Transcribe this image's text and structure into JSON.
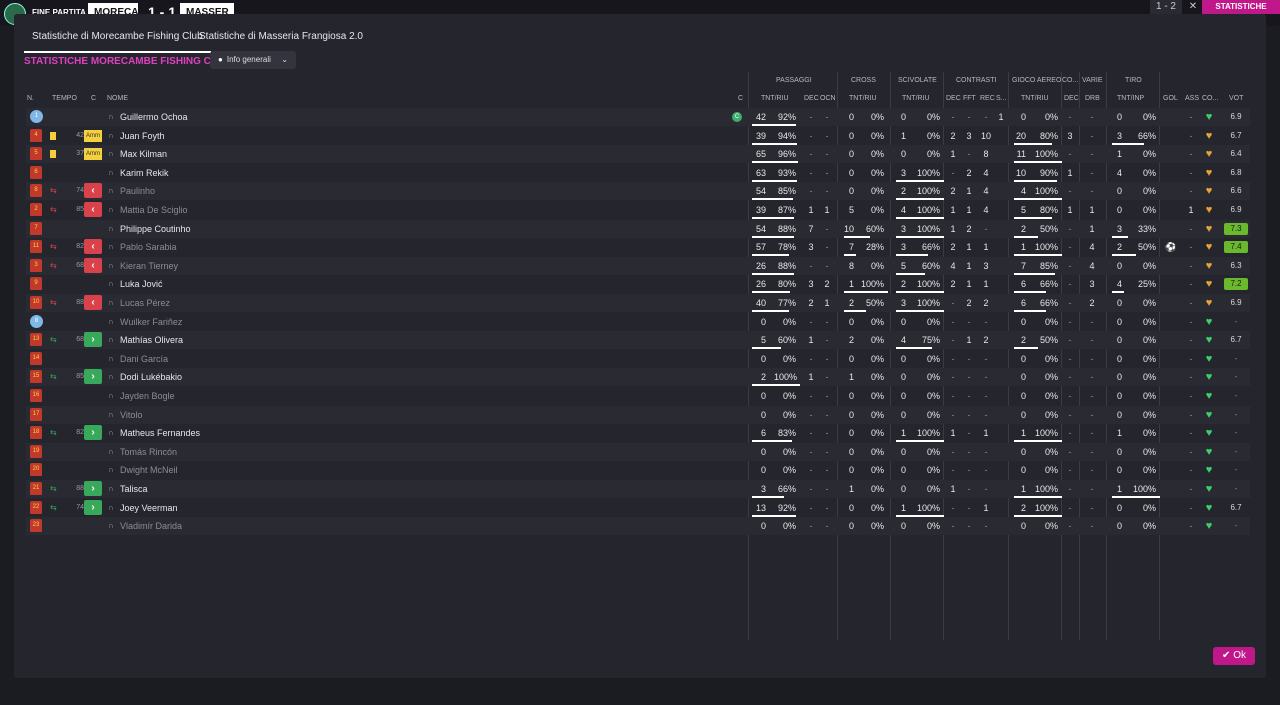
{
  "topbar": {
    "label": "FINE PARTITA",
    "team_home": "MORECA",
    "score": "1 - 1",
    "team_away": "MASSER",
    "right_score": "1 - 2",
    "right_x": "✕",
    "right_btn": "STATISTICHE"
  },
  "tabs": [
    {
      "label": "Statistiche di Morecambe Fishing Club"
    },
    {
      "label": "Statistiche di Masseria Frangiosa 2.0"
    }
  ],
  "heading": "STATISTICHE MORECAMBE FISHING CLUB",
  "dropdown": {
    "label": "Info generali"
  },
  "groups": [
    "PASSAGGI",
    "CROSS",
    "SCIVOLATE",
    "CONTRASTI",
    "GIOCO AEREO",
    "CO...",
    "VARIE",
    "TIRO"
  ],
  "cols": {
    "n": "N.",
    "tempo": "TEMPO",
    "c": "C",
    "nome": "NOME",
    "c2": "C",
    "pass": "TNT/RIU",
    "pdec": "DEC",
    "pocn": "OCN",
    "cross": "TNT/RIU",
    "sciv": "TNT/RIU",
    "cdec": "DEC",
    "cfft": "FFT",
    "crec": "REC",
    "cs": "S...",
    "aer": "TNT/RIU",
    "codec": "DEC",
    "drb": "DRB",
    "tiro": "TNT/INP",
    "gol": "GOL",
    "ass": "ASS",
    "co": "CO...",
    "vot": "VOT"
  },
  "players": [
    {
      "n": "1",
      "gk": true,
      "tempo": "",
      "card": "",
      "sub": "",
      "name": "Guillermo Ochoa",
      "cap": "C",
      "p": [
        "42",
        "92%"
      ],
      "pdec": "-",
      "pocn": "-",
      "cr": [
        "0",
        "0%"
      ],
      "sc": [
        "0",
        "0%"
      ],
      "cdec": "-",
      "cfft": "-",
      "crec": "-",
      "cs": "1",
      "ae": [
        "0",
        "0%"
      ],
      "codec": "-",
      "drb": "-",
      "ti": [
        "0",
        "0%"
      ],
      "gol": "",
      "ass": "-",
      "heart": "g",
      "vote": "6.9",
      "hi": false,
      "dim": false
    },
    {
      "n": "4",
      "tempo": "42",
      "card": "y",
      "cardlabel": "Amm",
      "sub": "",
      "name": "Juan Foyth",
      "p": [
        "39",
        "94%"
      ],
      "pdec": "-",
      "pocn": "-",
      "cr": [
        "0",
        "0%"
      ],
      "sc": [
        "1",
        "0%"
      ],
      "cdec": "2",
      "cfft": "3",
      "crec": "10",
      "cs": "",
      "ae": [
        "20",
        "80%"
      ],
      "codec": "3",
      "drb": "-",
      "ti": [
        "3",
        "66%"
      ],
      "gol": "",
      "ass": "-",
      "heart": "o",
      "vote": "6.7",
      "hi": false,
      "dim": false
    },
    {
      "n": "5",
      "tempo": "37",
      "card": "y",
      "cardlabel": "Amm",
      "sub": "",
      "name": "Max Kilman",
      "p": [
        "65",
        "96%"
      ],
      "pdec": "-",
      "pocn": "-",
      "cr": [
        "0",
        "0%"
      ],
      "sc": [
        "0",
        "0%"
      ],
      "cdec": "1",
      "cfft": "-",
      "crec": "8",
      "cs": "",
      "ae": [
        "11",
        "100%"
      ],
      "codec": "-",
      "drb": "-",
      "ti": [
        "1",
        "0%"
      ],
      "gol": "",
      "ass": "-",
      "heart": "o",
      "vote": "6.4",
      "hi": false,
      "dim": false
    },
    {
      "n": "6",
      "tempo": "",
      "card": "",
      "sub": "",
      "name": "Karim Rekik",
      "p": [
        "63",
        "93%"
      ],
      "pdec": "-",
      "pocn": "-",
      "cr": [
        "0",
        "0%"
      ],
      "sc": [
        "3",
        "100%"
      ],
      "cdec": "-",
      "cfft": "2",
      "crec": "4",
      "cs": "",
      "ae": [
        "10",
        "90%"
      ],
      "codec": "1",
      "drb": "-",
      "ti": [
        "4",
        "0%"
      ],
      "gol": "",
      "ass": "-",
      "heart": "o",
      "vote": "6.8",
      "hi": false,
      "dim": false
    },
    {
      "n": "8",
      "tempo": "74",
      "card": "",
      "sub": "out",
      "name": "Paulinho",
      "p": [
        "54",
        "85%"
      ],
      "pdec": "-",
      "pocn": "-",
      "cr": [
        "0",
        "0%"
      ],
      "sc": [
        "2",
        "100%"
      ],
      "cdec": "2",
      "cfft": "1",
      "crec": "4",
      "cs": "",
      "ae": [
        "4",
        "100%"
      ],
      "codec": "-",
      "drb": "-",
      "ti": [
        "0",
        "0%"
      ],
      "gol": "",
      "ass": "-",
      "heart": "o",
      "vote": "6.6",
      "hi": false,
      "dim": true
    },
    {
      "n": "2",
      "tempo": "85",
      "card": "",
      "sub": "out",
      "name": "Mattia De Sciglio",
      "p": [
        "39",
        "87%"
      ],
      "pdec": "1",
      "pocn": "1",
      "cr": [
        "5",
        "0%"
      ],
      "sc": [
        "4",
        "100%"
      ],
      "cdec": "1",
      "cfft": "1",
      "crec": "4",
      "cs": "",
      "ae": [
        "5",
        "80%"
      ],
      "codec": "1",
      "drb": "1",
      "ti": [
        "0",
        "0%"
      ],
      "gol": "",
      "ass": "1",
      "heart": "o",
      "vote": "6.9",
      "hi": false,
      "dim": true
    },
    {
      "n": "7",
      "tempo": "",
      "card": "",
      "sub": "",
      "name": "Philippe Coutinho",
      "p": [
        "54",
        "88%"
      ],
      "pdec": "7",
      "pocn": "-",
      "cr": [
        "10",
        "60%"
      ],
      "sc": [
        "3",
        "100%"
      ],
      "cdec": "1",
      "cfft": "2",
      "crec": "-",
      "cs": "",
      "ae": [
        "2",
        "50%"
      ],
      "codec": "-",
      "drb": "1",
      "ti": [
        "3",
        "33%"
      ],
      "gol": "",
      "ass": "-",
      "heart": "o",
      "vote": "7.3",
      "hi": true,
      "dim": false
    },
    {
      "n": "11",
      "tempo": "82",
      "card": "",
      "sub": "out",
      "name": "Pablo Sarabia",
      "p": [
        "57",
        "78%"
      ],
      "pdec": "3",
      "pocn": "-",
      "cr": [
        "7",
        "28%"
      ],
      "sc": [
        "3",
        "66%"
      ],
      "cdec": "2",
      "cfft": "1",
      "crec": "1",
      "cs": "",
      "ae": [
        "1",
        "100%"
      ],
      "codec": "-",
      "drb": "4",
      "ti": [
        "2",
        "50%"
      ],
      "gol": "⚽",
      "ass": "-",
      "heart": "o",
      "vote": "7.4",
      "hi": true,
      "dim": true
    },
    {
      "n": "3",
      "tempo": "68",
      "card": "",
      "sub": "out",
      "name": "Kieran Tierney",
      "p": [
        "26",
        "88%"
      ],
      "pdec": "-",
      "pocn": "-",
      "cr": [
        "8",
        "0%"
      ],
      "sc": [
        "5",
        "60%"
      ],
      "cdec": "4",
      "cfft": "1",
      "crec": "3",
      "cs": "",
      "ae": [
        "7",
        "85%"
      ],
      "codec": "-",
      "drb": "4",
      "ti": [
        "0",
        "0%"
      ],
      "gol": "",
      "ass": "-",
      "heart": "o",
      "vote": "6.3",
      "hi": false,
      "dim": true
    },
    {
      "n": "9",
      "tempo": "",
      "card": "",
      "sub": "",
      "name": "Luka Jović",
      "p": [
        "26",
        "80%"
      ],
      "pdec": "3",
      "pocn": "2",
      "cr": [
        "1",
        "100%"
      ],
      "sc": [
        "2",
        "100%"
      ],
      "cdec": "2",
      "cfft": "1",
      "crec": "1",
      "cs": "",
      "ae": [
        "6",
        "66%"
      ],
      "codec": "-",
      "drb": "3",
      "ti": [
        "4",
        "25%"
      ],
      "gol": "",
      "ass": "-",
      "heart": "o",
      "vote": "7.2",
      "hi": true,
      "dim": false
    },
    {
      "n": "10",
      "tempo": "88",
      "card": "",
      "sub": "out",
      "name": "Lucas Pérez",
      "p": [
        "40",
        "77%"
      ],
      "pdec": "2",
      "pocn": "1",
      "cr": [
        "2",
        "50%"
      ],
      "sc": [
        "3",
        "100%"
      ],
      "cdec": "-",
      "cfft": "2",
      "crec": "2",
      "cs": "",
      "ae": [
        "6",
        "66%"
      ],
      "codec": "-",
      "drb": "2",
      "ti": [
        "0",
        "0%"
      ],
      "gol": "",
      "ass": "-",
      "heart": "o",
      "vote": "6.9",
      "hi": false,
      "dim": true
    },
    {
      "n": "8",
      "gk": true,
      "tempo": "",
      "card": "",
      "sub": "",
      "name": "Wuilker Fariñez",
      "p": [
        "0",
        "0%"
      ],
      "pdec": "-",
      "pocn": "-",
      "cr": [
        "0",
        "0%"
      ],
      "sc": [
        "0",
        "0%"
      ],
      "cdec": "-",
      "cfft": "-",
      "crec": "-",
      "cs": "",
      "ae": [
        "0",
        "0%"
      ],
      "codec": "-",
      "drb": "-",
      "ti": [
        "0",
        "0%"
      ],
      "gol": "",
      "ass": "-",
      "heart": "g",
      "vote": "-",
      "hi": false,
      "dim": true
    },
    {
      "n": "13",
      "tempo": "68",
      "card": "",
      "sub": "in",
      "name": "Mathías Olivera",
      "p": [
        "5",
        "60%"
      ],
      "pdec": "1",
      "pocn": "-",
      "cr": [
        "2",
        "0%"
      ],
      "sc": [
        "4",
        "75%"
      ],
      "cdec": "-",
      "cfft": "1",
      "crec": "2",
      "cs": "",
      "ae": [
        "2",
        "50%"
      ],
      "codec": "-",
      "drb": "-",
      "ti": [
        "0",
        "0%"
      ],
      "gol": "",
      "ass": "-",
      "heart": "g",
      "vote": "6.7",
      "hi": false,
      "dim": false
    },
    {
      "n": "14",
      "tempo": "",
      "card": "",
      "sub": "",
      "name": "Dani García",
      "p": [
        "0",
        "0%"
      ],
      "pdec": "-",
      "pocn": "-",
      "cr": [
        "0",
        "0%"
      ],
      "sc": [
        "0",
        "0%"
      ],
      "cdec": "-",
      "cfft": "-",
      "crec": "-",
      "cs": "",
      "ae": [
        "0",
        "0%"
      ],
      "codec": "-",
      "drb": "-",
      "ti": [
        "0",
        "0%"
      ],
      "gol": "",
      "ass": "-",
      "heart": "g",
      "vote": "-",
      "hi": false,
      "dim": true
    },
    {
      "n": "15",
      "tempo": "85",
      "card": "",
      "sub": "in",
      "name": "Dodi Lukébakio",
      "p": [
        "2",
        "100%"
      ],
      "pdec": "1",
      "pocn": "-",
      "cr": [
        "1",
        "0%"
      ],
      "sc": [
        "0",
        "0%"
      ],
      "cdec": "-",
      "cfft": "-",
      "crec": "-",
      "cs": "",
      "ae": [
        "0",
        "0%"
      ],
      "codec": "-",
      "drb": "-",
      "ti": [
        "0",
        "0%"
      ],
      "gol": "",
      "ass": "-",
      "heart": "g",
      "vote": "-",
      "hi": false,
      "dim": false
    },
    {
      "n": "16",
      "tempo": "",
      "card": "",
      "sub": "",
      "name": "Jayden Bogle",
      "p": [
        "0",
        "0%"
      ],
      "pdec": "-",
      "pocn": "-",
      "cr": [
        "0",
        "0%"
      ],
      "sc": [
        "0",
        "0%"
      ],
      "cdec": "-",
      "cfft": "-",
      "crec": "-",
      "cs": "",
      "ae": [
        "0",
        "0%"
      ],
      "codec": "-",
      "drb": "-",
      "ti": [
        "0",
        "0%"
      ],
      "gol": "",
      "ass": "-",
      "heart": "g",
      "vote": "-",
      "hi": false,
      "dim": true
    },
    {
      "n": "17",
      "tempo": "",
      "card": "",
      "sub": "",
      "name": "Vitolo",
      "p": [
        "0",
        "0%"
      ],
      "pdec": "-",
      "pocn": "-",
      "cr": [
        "0",
        "0%"
      ],
      "sc": [
        "0",
        "0%"
      ],
      "cdec": "-",
      "cfft": "-",
      "crec": "-",
      "cs": "",
      "ae": [
        "0",
        "0%"
      ],
      "codec": "-",
      "drb": "-",
      "ti": [
        "0",
        "0%"
      ],
      "gol": "",
      "ass": "-",
      "heart": "g",
      "vote": "-",
      "hi": false,
      "dim": true
    },
    {
      "n": "18",
      "tempo": "82",
      "card": "",
      "sub": "in",
      "name": "Matheus Fernandes",
      "p": [
        "6",
        "83%"
      ],
      "pdec": "-",
      "pocn": "-",
      "cr": [
        "0",
        "0%"
      ],
      "sc": [
        "1",
        "100%"
      ],
      "cdec": "1",
      "cfft": "-",
      "crec": "1",
      "cs": "",
      "ae": [
        "1",
        "100%"
      ],
      "codec": "-",
      "drb": "-",
      "ti": [
        "1",
        "0%"
      ],
      "gol": "",
      "ass": "-",
      "heart": "g",
      "vote": "-",
      "hi": false,
      "dim": false
    },
    {
      "n": "19",
      "tempo": "",
      "card": "",
      "sub": "",
      "name": "Tomás Rincón",
      "p": [
        "0",
        "0%"
      ],
      "pdec": "-",
      "pocn": "-",
      "cr": [
        "0",
        "0%"
      ],
      "sc": [
        "0",
        "0%"
      ],
      "cdec": "-",
      "cfft": "-",
      "crec": "-",
      "cs": "",
      "ae": [
        "0",
        "0%"
      ],
      "codec": "-",
      "drb": "-",
      "ti": [
        "0",
        "0%"
      ],
      "gol": "",
      "ass": "-",
      "heart": "g",
      "vote": "-",
      "hi": false,
      "dim": true
    },
    {
      "n": "20",
      "tempo": "",
      "card": "",
      "sub": "",
      "name": "Dwight McNeil",
      "p": [
        "0",
        "0%"
      ],
      "pdec": "-",
      "pocn": "-",
      "cr": [
        "0",
        "0%"
      ],
      "sc": [
        "0",
        "0%"
      ],
      "cdec": "-",
      "cfft": "-",
      "crec": "-",
      "cs": "",
      "ae": [
        "0",
        "0%"
      ],
      "codec": "-",
      "drb": "-",
      "ti": [
        "0",
        "0%"
      ],
      "gol": "",
      "ass": "-",
      "heart": "g",
      "vote": "-",
      "hi": false,
      "dim": true
    },
    {
      "n": "21",
      "tempo": "88",
      "card": "",
      "sub": "in",
      "name": "Talisca",
      "p": [
        "3",
        "66%"
      ],
      "pdec": "-",
      "pocn": "-",
      "cr": [
        "1",
        "0%"
      ],
      "sc": [
        "0",
        "0%"
      ],
      "cdec": "1",
      "cfft": "-",
      "crec": "-",
      "cs": "",
      "ae": [
        "1",
        "100%"
      ],
      "codec": "-",
      "drb": "-",
      "ti": [
        "1",
        "100%"
      ],
      "gol": "",
      "ass": "-",
      "heart": "g",
      "vote": "-",
      "hi": false,
      "dim": false
    },
    {
      "n": "22",
      "tempo": "74",
      "card": "",
      "sub": "in",
      "name": "Joey Veerman",
      "p": [
        "13",
        "92%"
      ],
      "pdec": "-",
      "pocn": "-",
      "cr": [
        "0",
        "0%"
      ],
      "sc": [
        "1",
        "100%"
      ],
      "cdec": "-",
      "cfft": "-",
      "crec": "1",
      "cs": "",
      "ae": [
        "2",
        "100%"
      ],
      "codec": "-",
      "drb": "-",
      "ti": [
        "0",
        "0%"
      ],
      "gol": "",
      "ass": "-",
      "heart": "g",
      "vote": "6.7",
      "hi": false,
      "dim": false
    },
    {
      "n": "23",
      "tempo": "",
      "card": "",
      "sub": "",
      "name": "Vladimír Darida",
      "p": [
        "0",
        "0%"
      ],
      "pdec": "-",
      "pocn": "-",
      "cr": [
        "0",
        "0%"
      ],
      "sc": [
        "0",
        "0%"
      ],
      "cdec": "-",
      "cfft": "-",
      "crec": "-",
      "cs": "",
      "ae": [
        "0",
        "0%"
      ],
      "codec": "-",
      "drb": "-",
      "ti": [
        "0",
        "0%"
      ],
      "gol": "",
      "ass": "-",
      "heart": "g",
      "vote": "-",
      "hi": false,
      "dim": true
    }
  ],
  "ok": "Ok"
}
